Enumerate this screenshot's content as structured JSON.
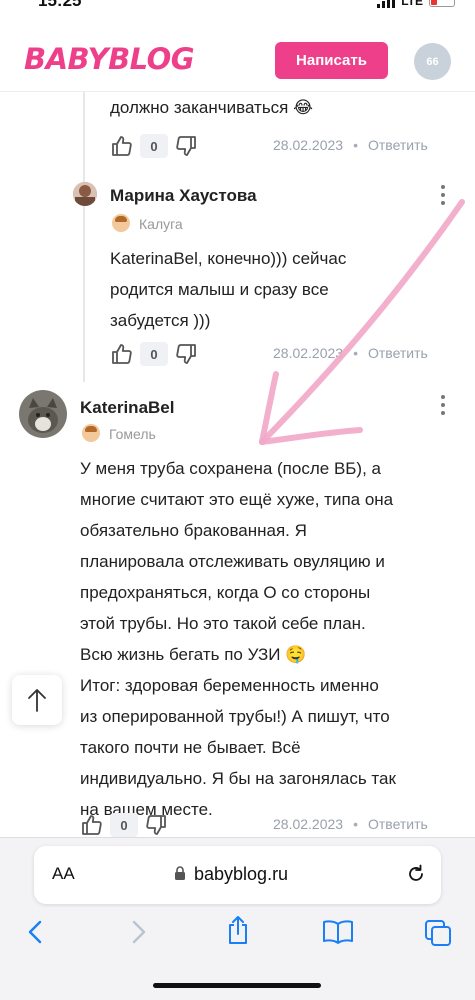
{
  "status": {
    "time": "15:25",
    "network": "LTE"
  },
  "header": {
    "logo": "BABYBLOG",
    "write_button": "Написать",
    "avatar_initials": "66"
  },
  "comments": [
    {
      "text_tail": "должно заканчиваться 😂",
      "likes": "0",
      "date": "28.02.2023",
      "reply_label": "Ответить"
    },
    {
      "author": "Марина Хаустова",
      "city": "Калуга",
      "text_lines": [
        "KaterinaBel, конечно))) сейчас",
        "родится малыш и сразу все",
        "забудется )))"
      ],
      "likes": "0",
      "date": "28.02.2023",
      "reply_label": "Ответить"
    },
    {
      "author": "KaterinaBel",
      "city": "Гомель",
      "text_lines": [
        "У меня труба сохранена (после ВБ), а",
        "многие считают это ещё хуже, типа она",
        "обязательно бракованная. Я",
        "планировала отслеживать овуляцию и",
        "предохраняться, когда О со стороны",
        "этой трубы. Но это такой себе план.",
        "Всю жизнь бегать по УЗИ 🤤",
        "Итог: здоровая беременность именно",
        "из оперированной трубы!) А пишут, что",
        "такого почти не бывает. Всё",
        "индивидуально. Я бы на загонялась так",
        "на вашем месте."
      ],
      "likes": "0",
      "date": "28.02.2023",
      "reply_label": "Ответить"
    }
  ],
  "browser": {
    "aa": "AA",
    "url": "babyblog.ru"
  },
  "icons": [
    "thumb-up-icon",
    "thumb-down-icon",
    "more-vertical-icon",
    "arrow-up-icon",
    "lock-icon",
    "reload-icon",
    "back-icon",
    "forward-icon",
    "share-icon",
    "bookmarks-icon",
    "tabs-icon"
  ],
  "colors": {
    "brand": "#ee3f8a",
    "annotation_arrow": "#f2a7c8"
  }
}
